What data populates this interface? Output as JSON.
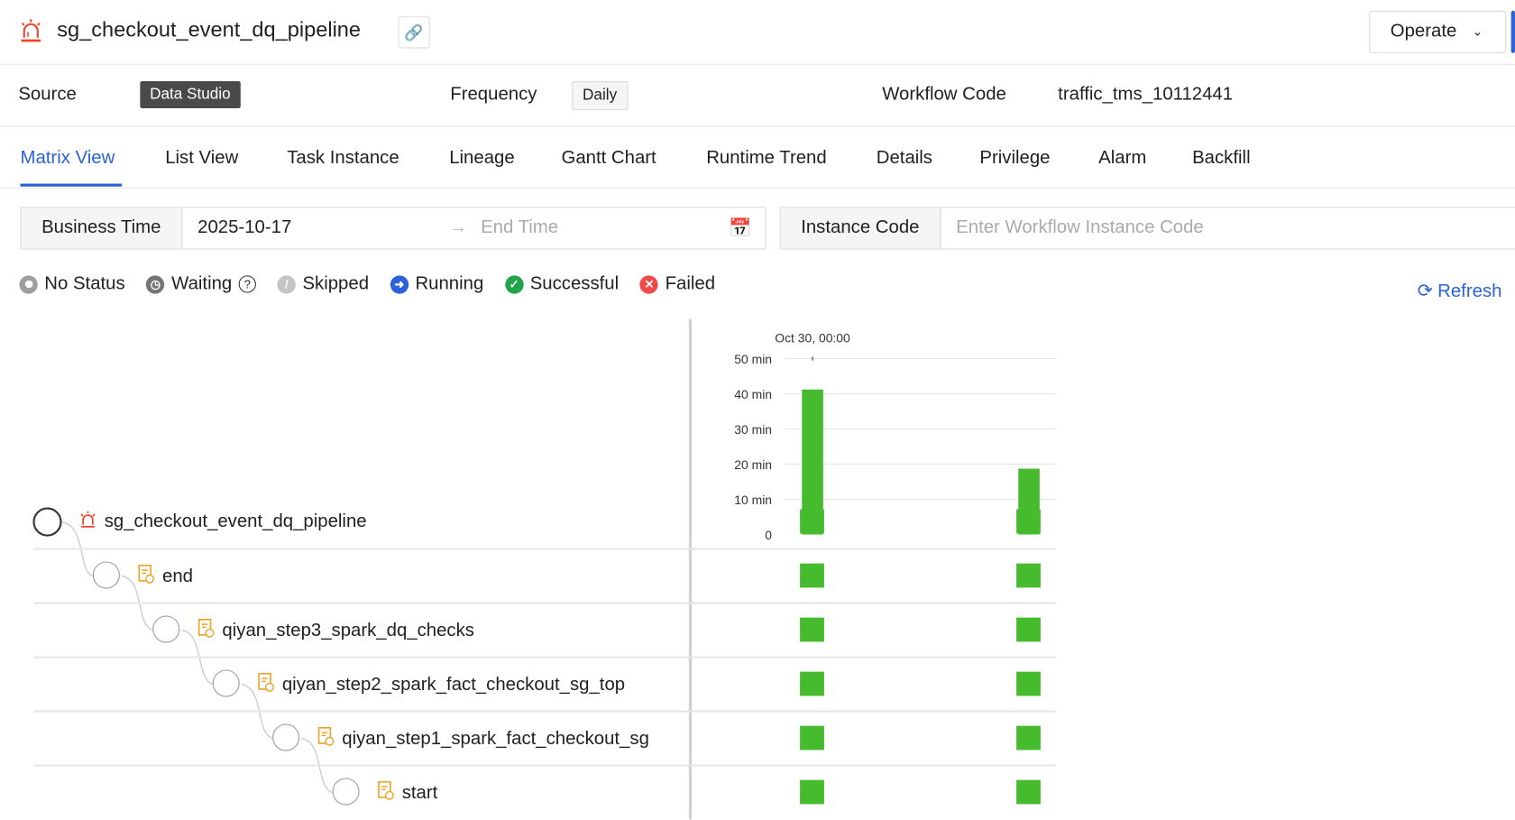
{
  "header": {
    "title": "sg_checkout_event_dq_pipeline",
    "operate_label": "Operate"
  },
  "info": {
    "source_label": "Source",
    "source_value": "Data Studio",
    "frequency_label": "Frequency",
    "frequency_value": "Daily",
    "code_label": "Workflow Code",
    "code_value": "traffic_tms_10112441"
  },
  "tabs": [
    {
      "label": "Matrix View"
    },
    {
      "label": "List View"
    },
    {
      "label": "Task Instance"
    },
    {
      "label": "Lineage"
    },
    {
      "label": "Gantt Chart"
    },
    {
      "label": "Runtime Trend"
    },
    {
      "label": "Details"
    },
    {
      "label": "Privilege"
    },
    {
      "label": "Alarm"
    },
    {
      "label": "Backfill"
    }
  ],
  "active_tab": "Matrix View",
  "filters": {
    "business_time_label": "Business Time",
    "start_value": "2025-10-17",
    "end_placeholder": "End Time",
    "instance_code_label": "Instance Code",
    "instance_code_placeholder": "Enter Workflow Instance Code"
  },
  "legend": [
    {
      "label": "No Status",
      "color": "#9e9e9e"
    },
    {
      "label": "Waiting",
      "color": "#757575"
    },
    {
      "label": "Skipped",
      "color": "#c4c4c4"
    },
    {
      "label": "Running",
      "color": "#2b62d9"
    },
    {
      "label": "Successful",
      "color": "#22a44a"
    },
    {
      "label": "Failed",
      "color": "#f04b4b"
    }
  ],
  "refresh_label": "Refresh",
  "tree": [
    {
      "label": "sg_checkout_event_dq_pipeline",
      "type": "workflow"
    },
    {
      "label": "end",
      "type": "task"
    },
    {
      "label": "qiyan_step3_spark_dq_checks",
      "type": "task"
    },
    {
      "label": "qiyan_step2_spark_fact_checkout_sg_top",
      "type": "task"
    },
    {
      "label": "qiyan_step1_spark_fact_checkout_sg",
      "type": "task"
    },
    {
      "label": "start",
      "type": "task"
    }
  ],
  "matrix_status": "Successful",
  "chart_data": {
    "type": "bar",
    "x_tick_label": "Oct 30, 00:00",
    "yticks": [
      "0",
      "10 min",
      "20 min",
      "30 min",
      "40 min",
      "50 min"
    ],
    "ylim": [
      0,
      50
    ],
    "values": [
      41.2,
      18.7
    ],
    "color": "#46bb2e",
    "grid": true
  }
}
